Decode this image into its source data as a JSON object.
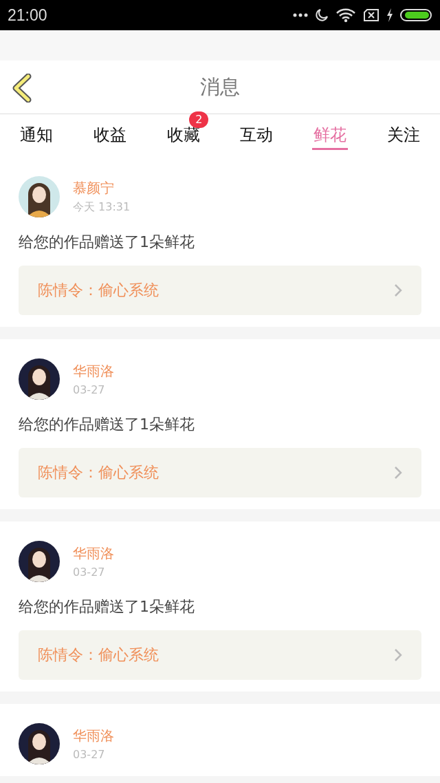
{
  "status_bar": {
    "time": "21:00"
  },
  "header": {
    "title": "消息"
  },
  "tabs": [
    {
      "label": "通知",
      "selected": false
    },
    {
      "label": "收益",
      "selected": false
    },
    {
      "label": "收藏",
      "selected": false,
      "badge": "2"
    },
    {
      "label": "互动",
      "selected": false
    },
    {
      "label": "鲜花",
      "selected": true
    },
    {
      "label": "关注",
      "selected": false
    }
  ],
  "messages": [
    {
      "name": "慕颜宁",
      "time": "今天 13:31",
      "text": "给您的作品赠送了1朵鲜花",
      "link": "陈情令：偷心系统"
    },
    {
      "name": "华雨洛",
      "time": "03-27",
      "text": "给您的作品赠送了1朵鲜花",
      "link": "陈情令：偷心系统"
    },
    {
      "name": "华雨洛",
      "time": "03-27",
      "text": "给您的作品赠送了1朵鲜花",
      "link": "陈情令：偷心系统"
    },
    {
      "name": "华雨洛",
      "time": "03-27"
    }
  ]
}
